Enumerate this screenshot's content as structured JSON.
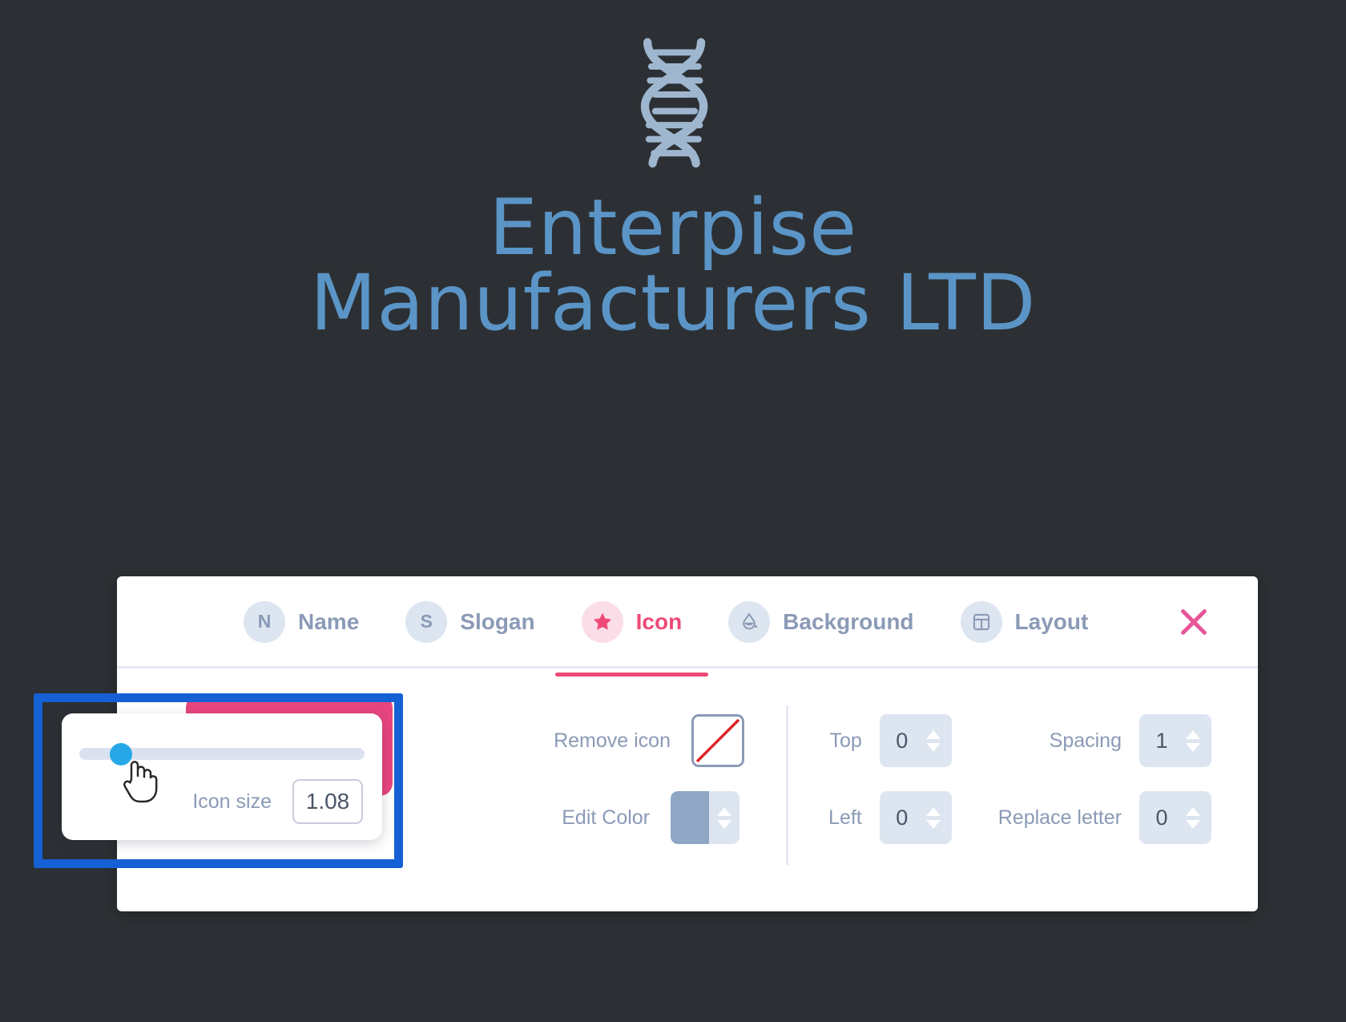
{
  "canvas": {
    "background_color": "#2c3034",
    "logo": {
      "icon_name": "dna-helix-icon",
      "icon_color": "#9fb6cf",
      "text_color": "#5b95c7",
      "name_line_1": "Enterpise",
      "name_line_2": "Manufacturers LTD"
    }
  },
  "editor": {
    "tabs": [
      {
        "id": "name",
        "badge": "N",
        "label": "Name",
        "active": false
      },
      {
        "id": "slogan",
        "badge": "S",
        "label": "Slogan",
        "active": false
      },
      {
        "id": "icon",
        "badge": "star-icon",
        "label": "Icon",
        "active": true
      },
      {
        "id": "background",
        "badge": "paint-drop-icon",
        "label": "Background",
        "active": false
      },
      {
        "id": "layout",
        "badge": "layout-icon",
        "label": "Layout",
        "active": false
      }
    ],
    "close_label": "close-icon",
    "active_tab_color": "#ef4a77",
    "inactive_tab_color": "#8b9ab6",
    "badge_color": "#dce5f0",
    "active_badge_color": "#fbdde8",
    "icon_card": {
      "name": "selected-icon-card",
      "color": "#e8457e"
    },
    "middle_controls": [
      {
        "id": "remove-icon",
        "label": "Remove icon",
        "control": "swatch-slash"
      },
      {
        "id": "edit-color",
        "label": "Edit Color",
        "control": "color-stepper",
        "value_color": "#8fa7c4"
      }
    ],
    "numeric_controls": [
      {
        "id": "top",
        "label": "Top",
        "value": "0"
      },
      {
        "id": "spacing",
        "label": "Spacing",
        "value": "1"
      },
      {
        "id": "left",
        "label": "Left",
        "value": "0"
      },
      {
        "id": "replace-letter",
        "label": "Replace letter",
        "value": "0"
      }
    ]
  },
  "slider_popup": {
    "slider_name": "icon-size-slider",
    "thumb_color": "#26a8e8",
    "track_color": "#dbe2ef",
    "size_label": "Icon size",
    "size_value": "1.08"
  },
  "annotation": {
    "highlight_color": "#1560d4",
    "target": "icon-size-slider-region"
  }
}
